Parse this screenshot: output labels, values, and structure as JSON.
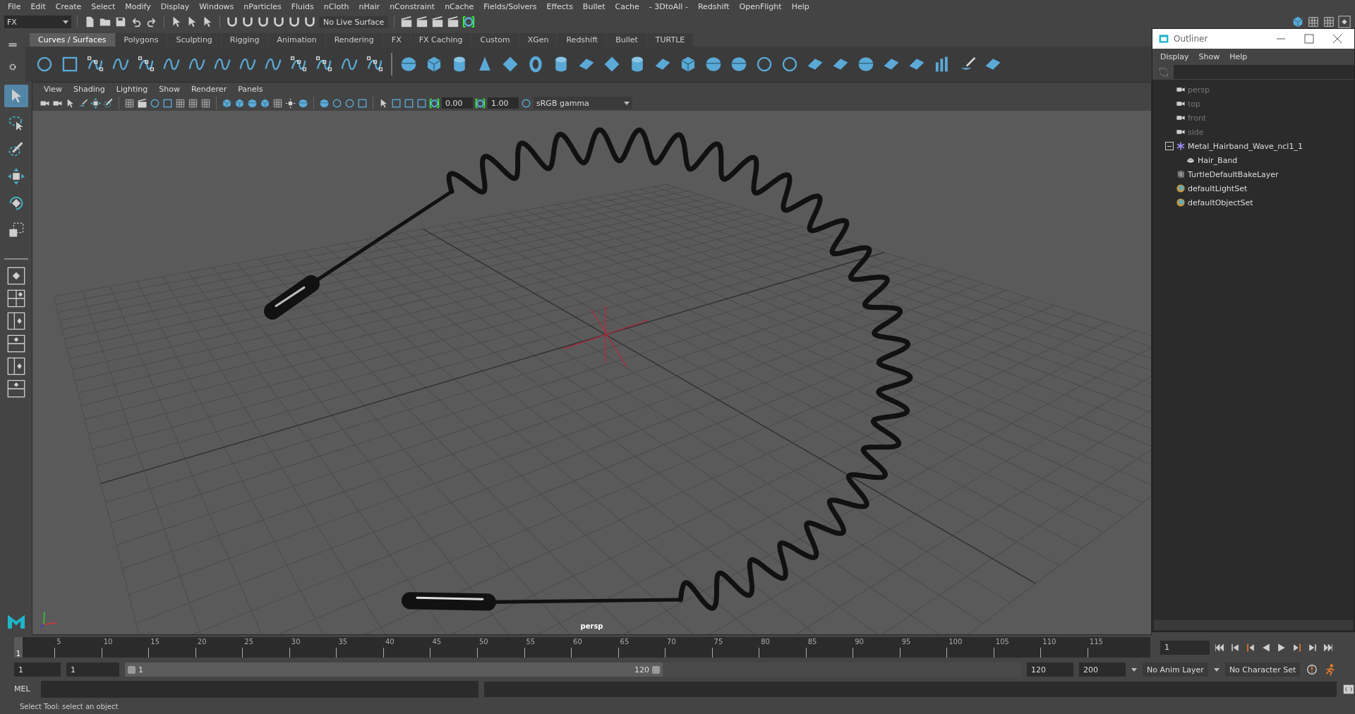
{
  "menu_bar": [
    "File",
    "Edit",
    "Create",
    "Select",
    "Modify",
    "Display",
    "Windows",
    "nParticles",
    "Fluids",
    "nCloth",
    "nHair",
    "nConstraint",
    "nCache",
    "Fields/Solvers",
    "Effects",
    "Bullet",
    "Cache",
    "- 3DtoAll -",
    "Redshift",
    "OpenFlight",
    "Help"
  ],
  "status_line": {
    "menu_set": "FX",
    "live_surface": "No Live Surface"
  },
  "shelf": {
    "tabs": [
      {
        "label": "Curves / Surfaces",
        "selected": true
      },
      {
        "label": "Polygons",
        "selected": false
      },
      {
        "label": "Sculpting",
        "selected": false
      },
      {
        "label": "Rigging",
        "selected": false
      },
      {
        "label": "Animation",
        "selected": false
      },
      {
        "label": "Rendering",
        "selected": false
      },
      {
        "label": "FX",
        "selected": false
      },
      {
        "label": "FX Caching",
        "selected": false
      },
      {
        "label": "Custom",
        "selected": false
      },
      {
        "label": "XGen",
        "selected": false
      },
      {
        "label": "Redshift",
        "selected": false
      },
      {
        "label": "Bullet",
        "selected": false
      },
      {
        "label": "TURTLE",
        "selected": false
      }
    ]
  },
  "toolbox": {
    "tools": [
      {
        "kind": "select",
        "selected": true
      },
      {
        "kind": "lasso",
        "selected": false
      },
      {
        "kind": "paint",
        "selected": false
      },
      {
        "kind": "move",
        "selected": false
      },
      {
        "kind": "rotate",
        "selected": false
      },
      {
        "kind": "scale",
        "selected": false
      }
    ]
  },
  "viewport": {
    "panel_menu": [
      "View",
      "Shading",
      "Lighting",
      "Show",
      "Renderer",
      "Panels"
    ],
    "exposure": "0.00",
    "gamma": "1.00",
    "color_space": "sRGB gamma",
    "camera_label": "persp"
  },
  "outliner": {
    "title": "Outliner",
    "menus": [
      "Display",
      "Show",
      "Help"
    ],
    "items": [
      {
        "kind": "camera",
        "label": "persp",
        "dimmed": true
      },
      {
        "kind": "camera",
        "label": "top",
        "dimmed": true
      },
      {
        "kind": "camera",
        "label": "front",
        "dimmed": true
      },
      {
        "kind": "camera",
        "label": "side",
        "dimmed": true
      },
      {
        "kind": "group",
        "label": "Metal_Hairband_Wave_ncl1_1",
        "dimmed": false,
        "expanded": true,
        "children": [
          {
            "kind": "mesh",
            "label": "Hair_Band",
            "dimmed": false
          }
        ]
      },
      {
        "kind": "layer",
        "label": "TurtleDefaultBakeLayer",
        "dimmed": false
      },
      {
        "kind": "set",
        "label": "defaultLightSet",
        "dimmed": false
      },
      {
        "kind": "set",
        "label": "defaultObjectSet",
        "dimmed": false
      }
    ]
  },
  "timeline": {
    "level": 0,
    "current_marker": "1",
    "tick_labels": [
      "5",
      "10",
      "15",
      "20",
      "25",
      "30",
      "35",
      "40",
      "45",
      "50",
      "55",
      "60",
      "65",
      "70",
      "75",
      "80",
      "85",
      "90",
      "95",
      "100",
      "105",
      "110",
      "115"
    ],
    "current_frame": "1"
  },
  "range": {
    "level": 0.6,
    "start": "1",
    "playback_start": "1",
    "slider_start": "1",
    "slider_end": "120",
    "playback_end": "120",
    "end": "200",
    "anim_layer": "No Anim Layer",
    "character_set": "No Character Set"
  },
  "command_line": {
    "language": "MEL"
  },
  "help_line": "Select Tool: select an object"
}
